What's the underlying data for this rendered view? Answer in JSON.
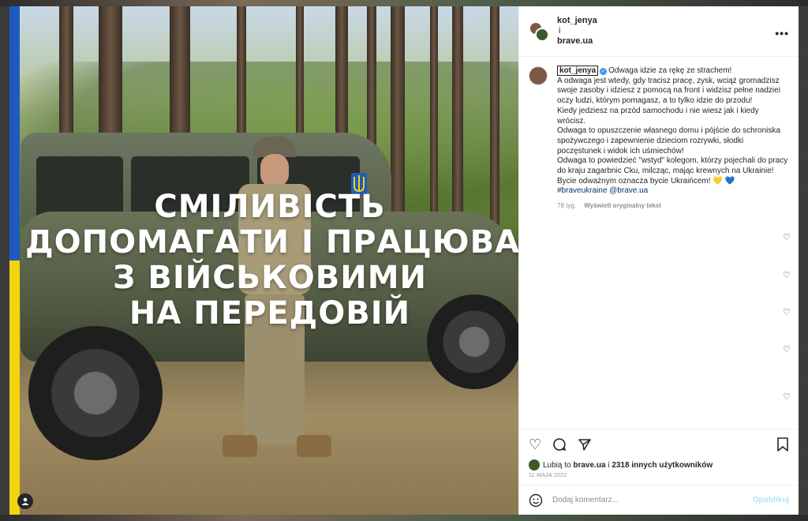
{
  "post": {
    "headline_lines": [
      "СМІЛИВІСТЬ",
      "ДОПОМАГАТИ І ПРАЦЮВАТИ",
      "З ВІЙСЬКОВИМИ",
      "НА ПЕРЕДОВІЙ"
    ]
  },
  "header": {
    "user1": "kot_jenya",
    "joiner": "i",
    "user2": "brave.ua",
    "more_icon": "more-horizontal-icon"
  },
  "caption": {
    "username": "kot_jenya",
    "lines": [
      "Odwaga idzie za rękę ze strachem!",
      "A odwaga jest wtedy, gdy tracisz pracę, zysk, wciąż gromadzisz swoje zasoby i idziesz z pomocą na front i widzisz pełne nadziei oczy ludzi, którym pomagasz, a to tylko idzie do przodu!",
      "Kiedy jedziesz na przód samochodu i nie wiesz jak i kiedy wrócisz.",
      "Odwaga to opuszczenie własnego domu i pójście do schroniska spożywczego i zapewnienie dzieciom rozrywki, słodki poczęstunek i widok ich uśmiechów!",
      "Odwaga to powiedzieć \"wstyd\" kolegom, którzy pojechali do pracy do kraju zagarbnic Cku, milcząc, mając krewnych na Ukrainie!",
      "Bycie odważnym oznacza bycie Ukraińcem!"
    ],
    "hearts": [
      "💛",
      "💙"
    ],
    "hashtags": "#braveukraine @brave.ua",
    "time_ago": "78 tyg.",
    "see_original": "Wyświetl oryginalny tekst"
  },
  "actions": {
    "like_icon": "heart-icon",
    "comment_icon": "comment-icon",
    "share_icon": "share-icon",
    "save_icon": "bookmark-icon"
  },
  "likes": {
    "prefix": "Lubią to",
    "user": "brave.ua",
    "joiner": "i",
    "others": "2318 innych użytkowników"
  },
  "date": "11 MAJA 2022",
  "comment": {
    "placeholder": "Dodaj komentarz...",
    "publish": "Opublikuj",
    "emoji_icon": "smiley-icon"
  },
  "colors": {
    "flag_blue": "#1d5bbf",
    "flag_yellow": "#f5d30f",
    "link": "#00376b",
    "publish_disabled": "#b2dffc"
  }
}
